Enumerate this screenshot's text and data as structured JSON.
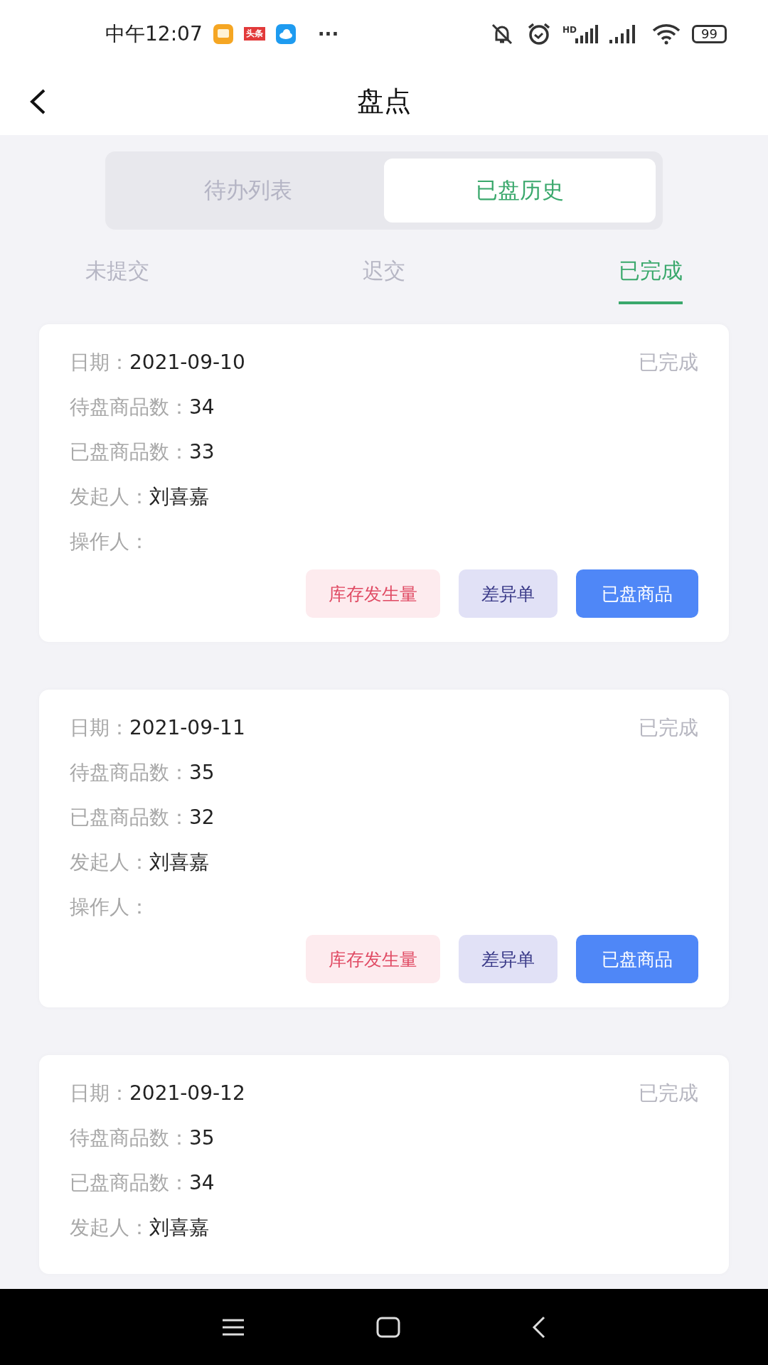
{
  "status_bar": {
    "time": "中午12:07",
    "app_badge": "头条",
    "more": "···",
    "network_label": "HD",
    "battery": "99"
  },
  "header": {
    "title": "盘点"
  },
  "segments": [
    {
      "label": "待办列表",
      "selected": false
    },
    {
      "label": "已盘历史",
      "selected": true
    }
  ],
  "filter_tabs": [
    {
      "label": "未提交",
      "selected": false
    },
    {
      "label": "迟交",
      "selected": false
    },
    {
      "label": "已完成",
      "selected": true
    }
  ],
  "records": [
    {
      "status": "已完成",
      "fields": [
        {
          "label": "日期：",
          "value": "2021-09-10"
        },
        {
          "label": "待盘商品数：",
          "value": "34"
        },
        {
          "label": "已盘商品数：",
          "value": "33"
        },
        {
          "label": "发起人：",
          "value": "刘喜嘉"
        },
        {
          "label": "操作人："
        }
      ],
      "actions": [
        {
          "label": "库存发生量",
          "kind": "stock"
        },
        {
          "label": "差异单",
          "kind": "diff"
        },
        {
          "label": "已盘商品",
          "kind": "primary"
        }
      ]
    },
    {
      "status": "已完成",
      "fields": [
        {
          "label": "日期：",
          "value": "2021-09-11"
        },
        {
          "label": "待盘商品数：",
          "value": "35"
        },
        {
          "label": "已盘商品数：",
          "value": "32"
        },
        {
          "label": "发起人：",
          "value": "刘喜嘉"
        },
        {
          "label": "操作人："
        }
      ],
      "actions": [
        {
          "label": "库存发生量",
          "kind": "stock"
        },
        {
          "label": "差异单",
          "kind": "diff"
        },
        {
          "label": "已盘商品",
          "kind": "primary"
        }
      ]
    },
    {
      "status": "已完成",
      "fields": [
        {
          "label": "日期：",
          "value": "2021-09-12"
        },
        {
          "label": "待盘商品数：",
          "value": "35"
        },
        {
          "label": "已盘商品数：",
          "value": "34"
        },
        {
          "label": "发起人：",
          "value": "刘喜嘉"
        }
      ]
    }
  ]
}
